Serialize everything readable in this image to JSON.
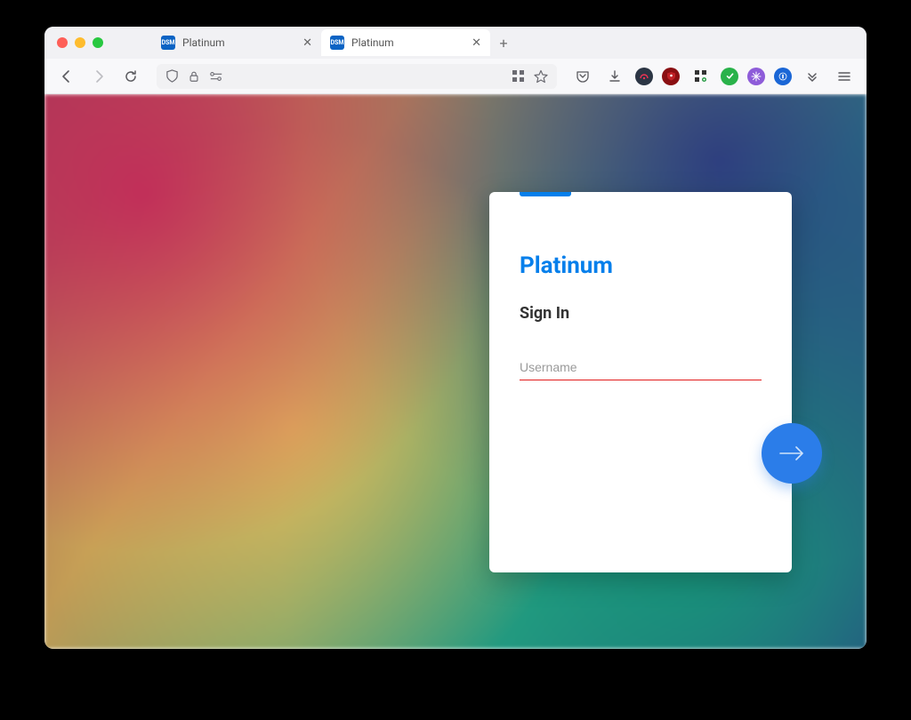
{
  "browser": {
    "tabs": [
      {
        "title": "Platinum",
        "favicon_text": "DSM",
        "active": false
      },
      {
        "title": "Platinum",
        "favicon_text": "DSM",
        "active": true
      }
    ]
  },
  "login": {
    "brand": "Platinum",
    "heading": "Sign In",
    "username_placeholder": "Username",
    "username_value": ""
  },
  "colors": {
    "accent_blue": "#057feb",
    "button_blue": "#2b7de9",
    "error_red": "#e21c1c"
  }
}
